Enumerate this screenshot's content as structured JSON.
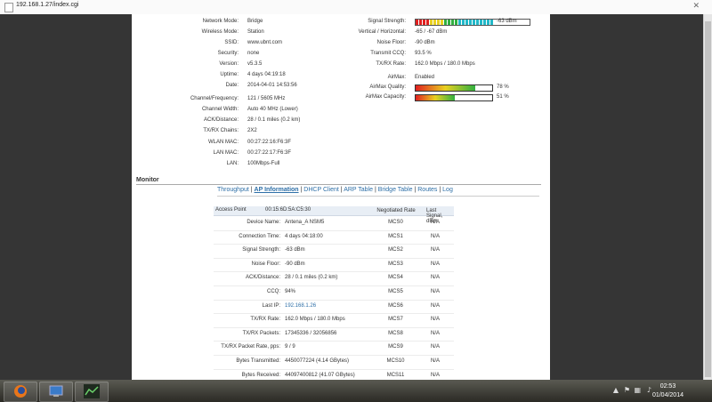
{
  "browser": {
    "url": "192.168.1.27/index.cgi",
    "close": "✕"
  },
  "status_left": [
    {
      "label": "Network Mode:",
      "value": "Bridge"
    },
    {
      "label": "Wireless Mode:",
      "value": "Station"
    },
    {
      "label": "SSID:",
      "value": "www.ubnt.com"
    },
    {
      "label": "Security:",
      "value": "none"
    },
    {
      "label": "Version:",
      "value": "v5.3.5"
    },
    {
      "label": "Uptime:",
      "value": "4 days 04:19:18"
    },
    {
      "label": "Date:",
      "value": "2014-04-01 14:53:56"
    },
    {
      "label": "Channel/Frequency:",
      "value": "121 / 5605 MHz"
    },
    {
      "label": "Channel Width:",
      "value": "Auto 40 MHz (Lower)"
    },
    {
      "label": "ACK/Distance:",
      "value": "28 / 0.1 miles (0.2 km)"
    },
    {
      "label": "TX/RX Chains:",
      "value": "2X2"
    },
    {
      "label": "WLAN MAC:",
      "value": "00:27:22:16:F6:3F"
    },
    {
      "label": "LAN MAC:",
      "value": "00:27:22:17:F6:3F"
    },
    {
      "label": "LAN:",
      "value": "100Mbps-Full"
    }
  ],
  "status_right": {
    "signal_label": "Signal Strength:",
    "signal_value": "-63 dBm",
    "vh_label": "Vertical / Horizontal:",
    "vh_value": "-65 / -67 dBm",
    "noise_label": "Noise Floor:",
    "noise_value": "-90 dBm",
    "ccq_label": "Transmit CCQ:",
    "ccq_value": "93.5 %",
    "rate_label": "TX/RX Rate:",
    "rate_value": "162.0 Mbps / 180.0 Mbps",
    "airmax_label": "AirMax:",
    "airmax_value": "Enabled",
    "quality_label": "AirMax Quality:",
    "quality_value": "78 %",
    "quality_fraction": 0.78,
    "capacity_label": "AirMax Capacity:",
    "capacity_value": "51 %",
    "capacity_fraction": 0.51
  },
  "monitor": {
    "title": "Monitor",
    "tabs": [
      {
        "label": "Throughput",
        "active": false
      },
      {
        "label": "AP Information",
        "active": true
      },
      {
        "label": "DHCP Client",
        "active": false
      },
      {
        "label": "ARP Table",
        "active": false
      },
      {
        "label": "Bridge Table",
        "active": false
      },
      {
        "label": "Routes",
        "active": false
      },
      {
        "label": "Log",
        "active": false
      }
    ],
    "ap_label": "Access Point",
    "ap_mac": "00:15:6D:5A:C5:30",
    "rate_header": "Negotiated Rate",
    "signal_header": "Last Signal, dBm",
    "rows": [
      {
        "k": "Device Name:",
        "v": "Antena_A NSM5",
        "m": "MCS0",
        "s": "N/A"
      },
      {
        "k": "Connection Time:",
        "v": "4 days 04:18:00",
        "m": "MCS1",
        "s": "N/A"
      },
      {
        "k": "Signal Strength:",
        "v": "-63 dBm",
        "m": "MCS2",
        "s": "N/A"
      },
      {
        "k": "Noise Floor:",
        "v": "-90 dBm",
        "m": "MCS3",
        "s": "N/A"
      },
      {
        "k": "ACK/Distance:",
        "v": "28 / 0.1 miles (0.2 km)",
        "m": "MCS4",
        "s": "N/A"
      },
      {
        "k": "CCQ:",
        "v": "94%",
        "m": "MCS5",
        "s": "N/A"
      },
      {
        "k": "Last IP:",
        "v": "192.168.1.26",
        "m": "MCS6",
        "s": "N/A",
        "link": true
      },
      {
        "k": "TX/RX Rate:",
        "v": "162.0 Mbps / 180.0 Mbps",
        "m": "MCS7",
        "s": "N/A"
      },
      {
        "k": "TX/RX Packets:",
        "v": "17345336 / 32056856",
        "m": "MCS8",
        "s": "N/A"
      },
      {
        "k": "TX/RX Packet Rate, pps:",
        "v": "9 / 9",
        "m": "MCS9",
        "s": "N/A"
      },
      {
        "k": "Bytes Transmitted:",
        "v": "4450077224 (4.14 GBytes)",
        "m": "MCS10",
        "s": "N/A"
      },
      {
        "k": "Bytes Received:",
        "v": "44097400812 (41.07 GBytes)",
        "m": "MCS11",
        "s": "N/A"
      }
    ]
  },
  "taskbar": {
    "time": "02:53",
    "date": "01/04/2014"
  },
  "colors": {
    "link": "#2e6fa7",
    "meter_red": "#e02020",
    "meter_yellow": "#e8d020",
    "meter_green": "#30b040",
    "meter_cyan": "#22b8c8"
  }
}
